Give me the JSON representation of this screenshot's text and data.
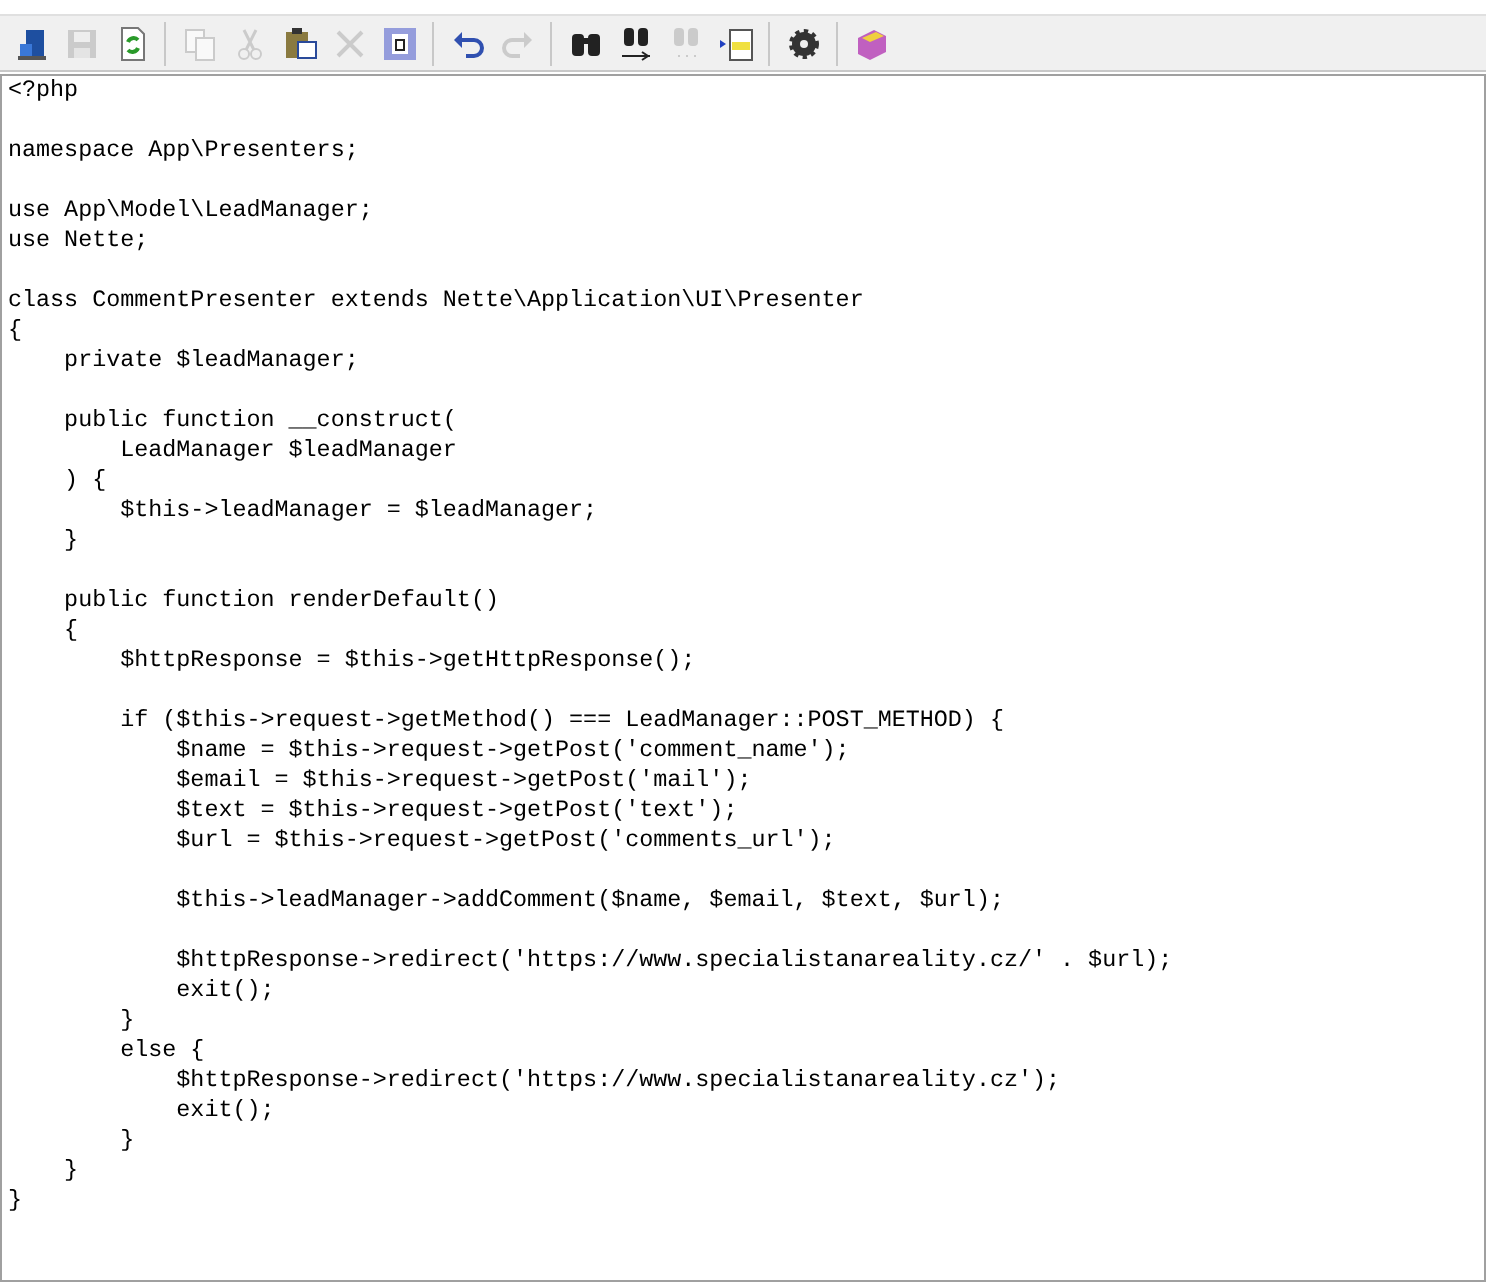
{
  "toolbar": [
    {
      "kind": "exit",
      "disabled": false
    },
    {
      "kind": "save",
      "disabled": true
    },
    {
      "kind": "refresh",
      "disabled": false
    },
    {
      "kind": "sep"
    },
    {
      "kind": "copy",
      "disabled": true
    },
    {
      "kind": "cut",
      "disabled": true
    },
    {
      "kind": "paste",
      "disabled": false
    },
    {
      "kind": "delete",
      "disabled": true
    },
    {
      "kind": "selectall",
      "disabled": false
    },
    {
      "kind": "sep"
    },
    {
      "kind": "undo",
      "disabled": false
    },
    {
      "kind": "redo",
      "disabled": true
    },
    {
      "kind": "sep"
    },
    {
      "kind": "find",
      "disabled": false
    },
    {
      "kind": "replace",
      "disabled": false
    },
    {
      "kind": "findnext",
      "disabled": true
    },
    {
      "kind": "gotoline",
      "disabled": false
    },
    {
      "kind": "sep"
    },
    {
      "kind": "settings",
      "disabled": false
    },
    {
      "kind": "sep"
    },
    {
      "kind": "help",
      "disabled": false
    }
  ],
  "editor": {
    "code": "<?php\n\nnamespace App\\Presenters;\n\nuse App\\Model\\LeadManager;\nuse Nette;\n\nclass CommentPresenter extends Nette\\Application\\UI\\Presenter\n{\n    private $leadManager;\n\n    public function __construct(\n        LeadManager $leadManager\n    ) {\n        $this->leadManager = $leadManager;\n    }\n\n    public function renderDefault()\n    {\n        $httpResponse = $this->getHttpResponse();\n\n        if ($this->request->getMethod() === LeadManager::POST_METHOD) {\n            $name = $this->request->getPost('comment_name');\n            $email = $this->request->getPost('mail');\n            $text = $this->request->getPost('text');\n            $url = $this->request->getPost('comments_url');\n\n            $this->leadManager->addComment($name, $email, $text, $url);\n\n            $httpResponse->redirect('https://www.specialistanareality.cz/' . $url);\n            exit();\n        }\n        else {\n            $httpResponse->redirect('https://www.specialistanareality.cz');\n            exit();\n        }\n    }\n}"
  }
}
